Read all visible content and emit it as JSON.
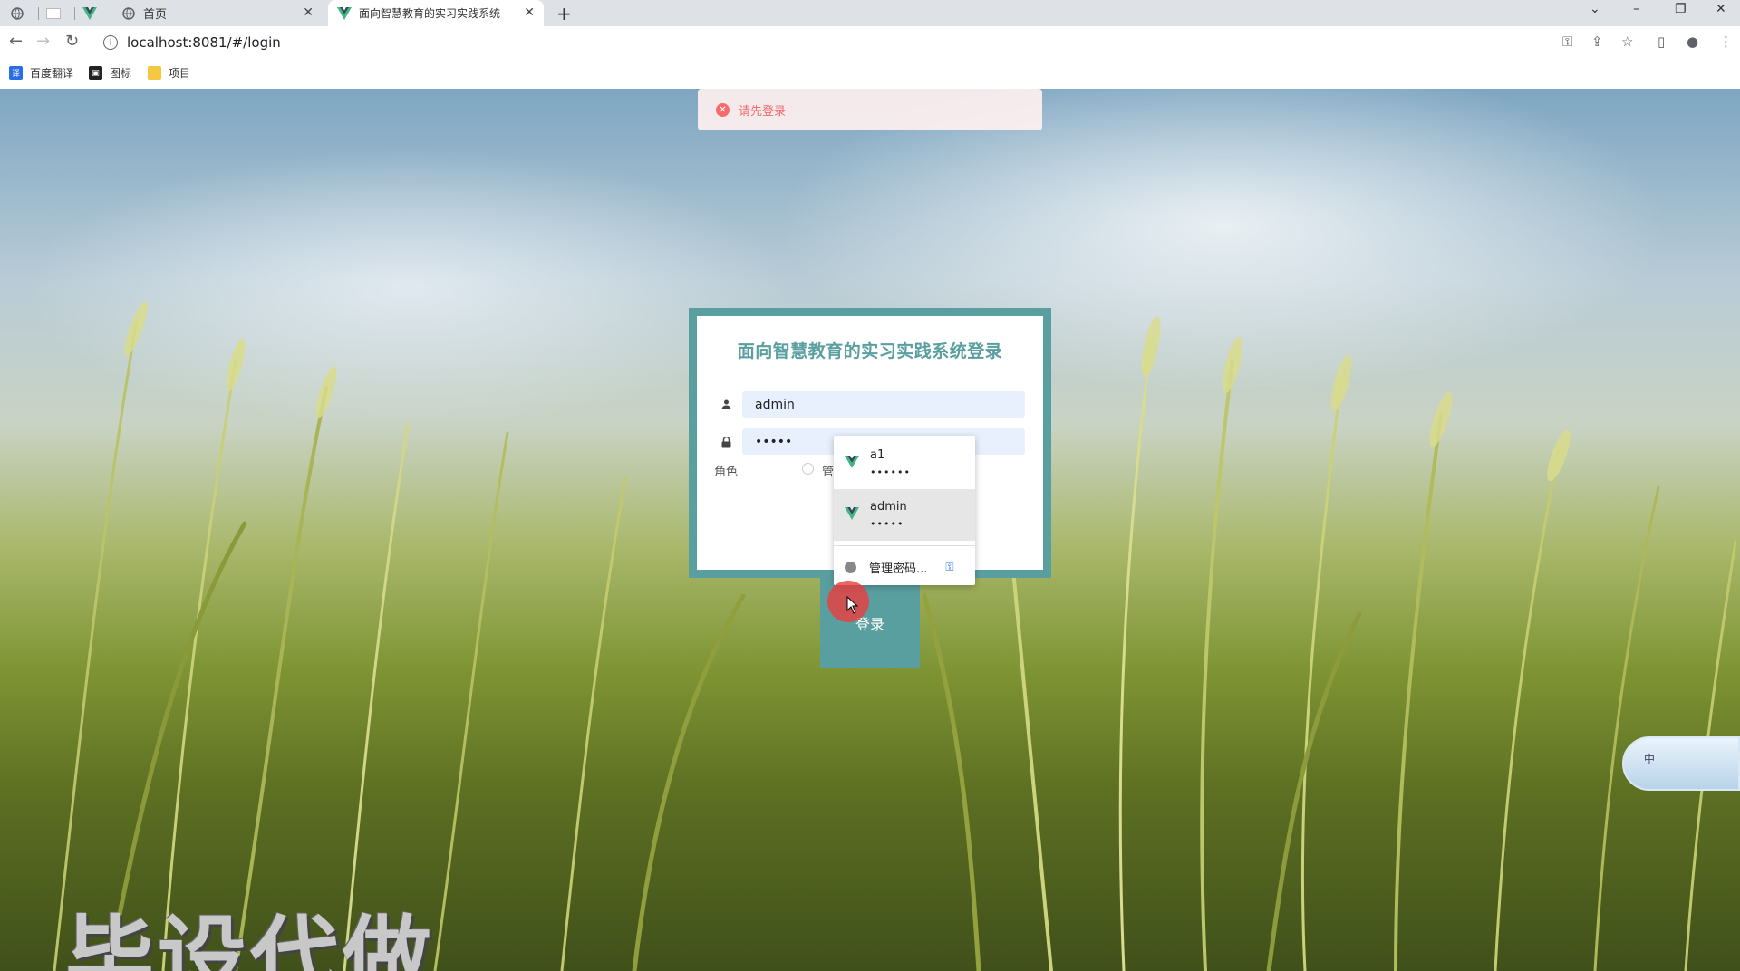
{
  "browser": {
    "tabs": [
      {
        "label": "首页",
        "active": false
      },
      {
        "label": "面向智慧教育的实习实践系统",
        "active": true
      }
    ],
    "new_tab": "+",
    "url": "localhost:8081/#/login",
    "bookmarks": [
      {
        "label": "百度翻译",
        "icon": "translate-icon",
        "color": "#2b6de5"
      },
      {
        "label": "图标",
        "icon": "image-icon",
        "color": "#222222"
      },
      {
        "label": "项目",
        "icon": "folder-icon",
        "color": "#f5c842"
      }
    ]
  },
  "alert": {
    "message": "请先登录",
    "color": "#f56c6c"
  },
  "login": {
    "title": "面向智慧教育的实习实践系统登录",
    "username_value": "admin",
    "password_value": "•••••",
    "role_label": "角色",
    "role_option": "管理",
    "submit_label": "登录",
    "accent_color": "#5a9fa0"
  },
  "autofill": {
    "items": [
      {
        "user": "a1",
        "password": "••••••"
      },
      {
        "user": "admin",
        "password": "•••••"
      }
    ],
    "manage_label": "管理密码...",
    "manage_icon": "key-icon"
  },
  "watermark": "毕设代做",
  "ime": {
    "label": "中"
  }
}
